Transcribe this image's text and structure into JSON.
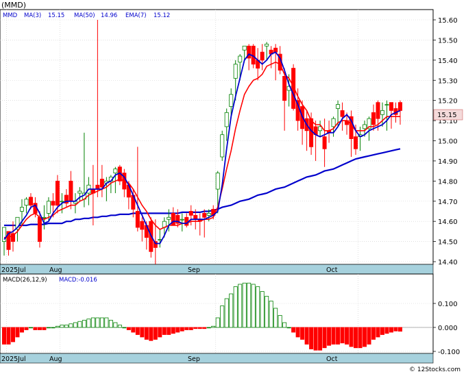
{
  "header": {
    "title": "(MMD)",
    "ticker": "MMD",
    "indicators": [
      {
        "label": "MA(3)",
        "value": "15.15",
        "color": "#0000cc"
      },
      {
        "label": "MA(50)",
        "value": "14.96",
        "color": "#0000cc"
      },
      {
        "label": "EMA(7)",
        "value": "15.12",
        "color": "#0000cc"
      }
    ]
  },
  "price_axis": {
    "ticks": [
      "15.60",
      "15.50",
      "15.40",
      "15.30",
      "15.20",
      "15.10",
      "15.00",
      "14.90",
      "14.80",
      "14.70",
      "14.60",
      "14.50",
      "14.40"
    ],
    "current_price": "15.15"
  },
  "x_axis": {
    "labels": [
      "2025Jul",
      "Aug",
      "Sep",
      "Oct"
    ]
  },
  "macd": {
    "label": "MACD(26,12,9)",
    "value_label": "MACD:-0.016",
    "ticks": [
      "0.100",
      "0.000",
      "-0.100"
    ]
  },
  "footer": {
    "watermark": "© 12Stocks.com"
  },
  "colors": {
    "up_candle_fill": "#ffffff",
    "up_candle_stroke": "#008000",
    "down_candle": "#ff0000",
    "ma_line": "#0000cc",
    "ema_line": "#ff0000",
    "axis_band": "#a6d1dd",
    "grid": "#cccccc"
  },
  "chart_data": [
    {
      "type": "candlestick",
      "title": "(MMD)",
      "x_labels": [
        "2025Jul",
        "Aug",
        "Sep",
        "Oct"
      ],
      "ylim": [
        14.38,
        15.64
      ],
      "grid": true,
      "series": [
        {
          "name": "MMD",
          "ohlc": [
            [
              14.5,
              14.57,
              14.43,
              14.57
            ],
            [
              14.55,
              14.55,
              14.43,
              14.46
            ],
            [
              14.54,
              14.6,
              14.45,
              14.5
            ],
            [
              14.56,
              14.62,
              14.5,
              14.62
            ],
            [
              14.65,
              14.71,
              14.58,
              14.67
            ],
            [
              14.68,
              14.72,
              14.64,
              14.71
            ],
            [
              14.72,
              14.74,
              14.66,
              14.68
            ],
            [
              14.69,
              14.72,
              14.62,
              14.64
            ],
            [
              14.62,
              14.65,
              14.47,
              14.5
            ],
            [
              14.62,
              14.68,
              14.56,
              14.62
            ],
            [
              14.64,
              14.72,
              14.6,
              14.7
            ],
            [
              14.7,
              14.74,
              14.62,
              14.68
            ],
            [
              14.8,
              14.83,
              14.64,
              14.68
            ],
            [
              14.7,
              14.74,
              14.64,
              14.7
            ],
            [
              14.73,
              14.76,
              14.67,
              14.69
            ],
            [
              14.8,
              14.85,
              14.66,
              14.7
            ],
            [
              14.69,
              14.74,
              14.64,
              14.7
            ],
            [
              14.74,
              14.77,
              14.7,
              14.75
            ],
            [
              14.71,
              15.04,
              14.67,
              14.74
            ],
            [
              14.74,
              14.82,
              14.68,
              14.78
            ],
            [
              14.76,
              14.88,
              14.58,
              14.74
            ],
            [
              14.78,
              15.6,
              14.72,
              14.76
            ],
            [
              14.81,
              14.88,
              14.72,
              14.77
            ],
            [
              14.79,
              14.82,
              14.7,
              14.8
            ],
            [
              14.8,
              14.83,
              14.74,
              14.82
            ],
            [
              14.84,
              14.87,
              14.74,
              14.86
            ],
            [
              14.87,
              14.88,
              14.78,
              14.8
            ],
            [
              14.84,
              14.86,
              14.72,
              14.76
            ],
            [
              14.78,
              14.8,
              14.66,
              14.72
            ],
            [
              14.73,
              14.76,
              14.62,
              14.66
            ],
            [
              14.65,
              14.97,
              14.55,
              14.57
            ],
            [
              14.6,
              14.62,
              14.5,
              14.56
            ],
            [
              14.58,
              14.6,
              14.46,
              14.52
            ],
            [
              14.6,
              14.62,
              14.42,
              14.45
            ],
            [
              14.5,
              14.61,
              14.38,
              14.47
            ],
            [
              14.51,
              14.56,
              14.47,
              14.51
            ],
            [
              14.57,
              14.62,
              14.52,
              14.6
            ],
            [
              14.61,
              14.66,
              14.55,
              14.62
            ],
            [
              14.64,
              14.67,
              14.58,
              14.58
            ],
            [
              14.63,
              14.66,
              14.57,
              14.59
            ],
            [
              14.61,
              14.64,
              14.55,
              14.61
            ],
            [
              14.62,
              14.64,
              14.57,
              14.58
            ],
            [
              14.65,
              14.68,
              14.58,
              14.63
            ],
            [
              14.63,
              14.66,
              14.56,
              14.61
            ],
            [
              14.61,
              14.64,
              14.53,
              14.6
            ],
            [
              14.64,
              14.66,
              14.52,
              14.62
            ],
            [
              14.63,
              14.66,
              14.6,
              14.64
            ],
            [
              14.66,
              14.68,
              14.61,
              14.63
            ],
            [
              14.76,
              14.85,
              14.64,
              14.84
            ],
            [
              14.92,
              15.05,
              14.9,
              15.03
            ],
            [
              15.07,
              15.16,
              15.0,
              15.14
            ],
            [
              15.17,
              15.26,
              15.12,
              15.23
            ],
            [
              15.31,
              15.4,
              15.2,
              15.38
            ],
            [
              15.39,
              15.43,
              15.3,
              15.42
            ],
            [
              15.45,
              15.47,
              15.4,
              15.47
            ],
            [
              15.47,
              15.48,
              15.35,
              15.41
            ],
            [
              15.47,
              15.48,
              15.36,
              15.38
            ],
            [
              15.4,
              15.46,
              15.3,
              15.36
            ],
            [
              15.44,
              15.48,
              15.35,
              15.4
            ],
            [
              15.47,
              15.49,
              15.4,
              15.48
            ],
            [
              15.45,
              15.47,
              15.36,
              15.43
            ],
            [
              15.46,
              15.48,
              15.3,
              15.44
            ],
            [
              15.43,
              15.47,
              15.33,
              15.35
            ],
            [
              15.32,
              15.36,
              15.05,
              15.2
            ],
            [
              15.25,
              15.33,
              15.17,
              15.27
            ],
            [
              15.36,
              15.38,
              15.15,
              15.16
            ],
            [
              15.2,
              15.26,
              15.05,
              15.1
            ],
            [
              15.17,
              15.2,
              14.98,
              15.06
            ],
            [
              15.11,
              15.15,
              14.95,
              15.05
            ],
            [
              15.11,
              15.14,
              14.93,
              14.97
            ],
            [
              15.07,
              15.1,
              14.9,
              15.03
            ],
            [
              15.05,
              15.1,
              15.02,
              15.07
            ],
            [
              15.02,
              15.11,
              14.87,
              14.96
            ],
            [
              15.05,
              15.1,
              14.99,
              15.04
            ],
            [
              15.07,
              15.12,
              15.02,
              15.11
            ],
            [
              15.16,
              15.2,
              15.07,
              15.18
            ],
            [
              15.15,
              15.19,
              15.05,
              15.12
            ],
            [
              15.1,
              15.14,
              15.03,
              15.08
            ],
            [
              15.12,
              15.15,
              14.92,
              15.01
            ],
            [
              15.02,
              15.08,
              14.93,
              14.96
            ],
            [
              15.02,
              15.07,
              14.95,
              15.03
            ],
            [
              15.06,
              15.1,
              15.02,
              15.08
            ],
            [
              15.06,
              15.12,
              15.0,
              15.11
            ],
            [
              15.14,
              15.18,
              15.05,
              15.08
            ],
            [
              15.19,
              15.2,
              15.05,
              15.11
            ],
            [
              15.13,
              15.19,
              15.07,
              15.15
            ],
            [
              15.18,
              15.2,
              15.05,
              15.18
            ],
            [
              15.19,
              15.18,
              15.06,
              15.15
            ],
            [
              15.16,
              15.19,
              15.09,
              15.13
            ],
            [
              15.19,
              15.2,
              15.08,
              15.15
            ]
          ]
        },
        {
          "name": "MA(3)",
          "values": [
            14.51,
            14.54,
            14.55,
            14.57,
            14.6,
            14.63,
            14.67,
            14.68,
            14.64,
            14.59,
            14.6,
            14.64,
            14.67,
            14.69,
            14.7,
            14.7,
            14.7,
            14.72,
            14.73,
            14.76,
            14.76,
            14.76,
            14.76,
            14.79,
            14.8,
            14.83,
            14.84,
            14.82,
            14.78,
            14.73,
            14.68,
            14.63,
            14.58,
            14.53,
            14.49,
            14.49,
            14.53,
            14.58,
            14.6,
            14.6,
            14.59,
            14.59,
            14.61,
            14.61,
            14.61,
            14.61,
            14.62,
            14.63,
            14.65,
            14.78,
            14.96,
            15.12,
            15.22,
            15.31,
            15.4,
            15.43,
            15.42,
            15.4,
            15.38,
            15.4,
            15.43,
            15.44,
            15.41,
            15.35,
            15.28,
            15.23,
            15.18,
            15.12,
            15.08,
            15.05,
            15.03,
            15.02,
            15.03,
            15.04,
            15.04,
            15.07,
            15.11,
            15.13,
            15.1,
            15.05,
            15.02,
            15.03,
            15.05,
            15.06,
            15.07,
            15.08,
            15.1,
            15.13,
            15.14,
            15.15
          ]
        },
        {
          "name": "EMA(7)",
          "values": [
            14.52,
            14.52,
            14.53,
            14.55,
            14.58,
            14.61,
            14.63,
            14.64,
            14.62,
            14.61,
            14.62,
            14.63,
            14.65,
            14.66,
            14.67,
            14.68,
            14.68,
            14.7,
            14.71,
            14.73,
            14.74,
            14.75,
            14.76,
            14.77,
            14.79,
            14.8,
            14.81,
            14.8,
            14.79,
            14.76,
            14.72,
            14.68,
            14.65,
            14.61,
            14.58,
            14.56,
            14.57,
            14.58,
            14.58,
            14.58,
            14.59,
            14.59,
            14.6,
            14.6,
            14.6,
            14.61,
            14.61,
            14.62,
            14.67,
            14.76,
            14.86,
            14.95,
            15.06,
            15.15,
            15.23,
            15.27,
            15.3,
            15.31,
            15.33,
            15.37,
            15.38,
            15.39,
            15.38,
            15.33,
            15.31,
            15.27,
            15.22,
            15.18,
            15.15,
            15.1,
            15.08,
            15.08,
            15.05,
            15.05,
            15.06,
            15.09,
            15.1,
            15.1,
            15.08,
            15.05,
            15.05,
            15.05,
            15.07,
            15.07,
            15.08,
            15.1,
            15.12,
            15.12,
            15.12,
            15.12
          ]
        },
        {
          "name": "MA(50)",
          "values": [
            14.58,
            14.58,
            14.58,
            14.58,
            14.58,
            14.58,
            14.585,
            14.585,
            14.585,
            14.585,
            14.59,
            14.59,
            14.59,
            14.59,
            14.6,
            14.6,
            14.61,
            14.61,
            14.615,
            14.615,
            14.62,
            14.62,
            14.625,
            14.625,
            14.63,
            14.63,
            14.635,
            14.635,
            14.635,
            14.64,
            14.64,
            14.64,
            14.64,
            14.64,
            14.64,
            14.64,
            14.64,
            14.64,
            14.64,
            14.64,
            14.645,
            14.645,
            14.645,
            14.645,
            14.645,
            14.65,
            14.65,
            14.655,
            14.66,
            14.67,
            14.675,
            14.68,
            14.69,
            14.7,
            14.705,
            14.71,
            14.72,
            14.73,
            14.735,
            14.74,
            14.75,
            14.76,
            14.765,
            14.77,
            14.78,
            14.79,
            14.8,
            14.81,
            14.82,
            14.825,
            14.83,
            14.84,
            14.85,
            14.855,
            14.86,
            14.87,
            14.88,
            14.89,
            14.9,
            14.91,
            14.915,
            14.92,
            14.925,
            14.93,
            14.935,
            14.94,
            14.945,
            14.95,
            14.955,
            14.96
          ]
        }
      ]
    },
    {
      "type": "bar",
      "title": "MACD(26,12,9)",
      "ylim": [
        -0.11,
        0.18
      ],
      "grid": true,
      "series": [
        {
          "name": "MACD",
          "values": [
            -0.07,
            -0.07,
            -0.06,
            -0.04,
            -0.02,
            -0.01,
            0,
            -0.01,
            -0.01,
            -0.01,
            0,
            0,
            0.005,
            0.01,
            0.01,
            0.015,
            0.02,
            0.025,
            0.03,
            0.035,
            0.04,
            0.04,
            0.04,
            0.04,
            0.03,
            0.02,
            0.01,
            0,
            -0.01,
            -0.02,
            -0.03,
            -0.04,
            -0.05,
            -0.055,
            -0.05,
            -0.04,
            -0.03,
            -0.03,
            -0.025,
            -0.02,
            -0.015,
            -0.01,
            -0.01,
            -0.005,
            -0.005,
            -0.005,
            0,
            0.005,
            0.04,
            0.09,
            0.12,
            0.14,
            0.17,
            0.18,
            0.185,
            0.185,
            0.18,
            0.17,
            0.15,
            0.13,
            0.11,
            0.08,
            0.05,
            0.02,
            0,
            -0.02,
            -0.04,
            -0.05,
            -0.07,
            -0.09,
            -0.095,
            -0.095,
            -0.085,
            -0.075,
            -0.07,
            -0.07,
            -0.065,
            -0.07,
            -0.08,
            -0.085,
            -0.085,
            -0.08,
            -0.07,
            -0.05,
            -0.04,
            -0.03,
            -0.025,
            -0.02,
            -0.015,
            -0.016
          ]
        }
      ]
    }
  ]
}
